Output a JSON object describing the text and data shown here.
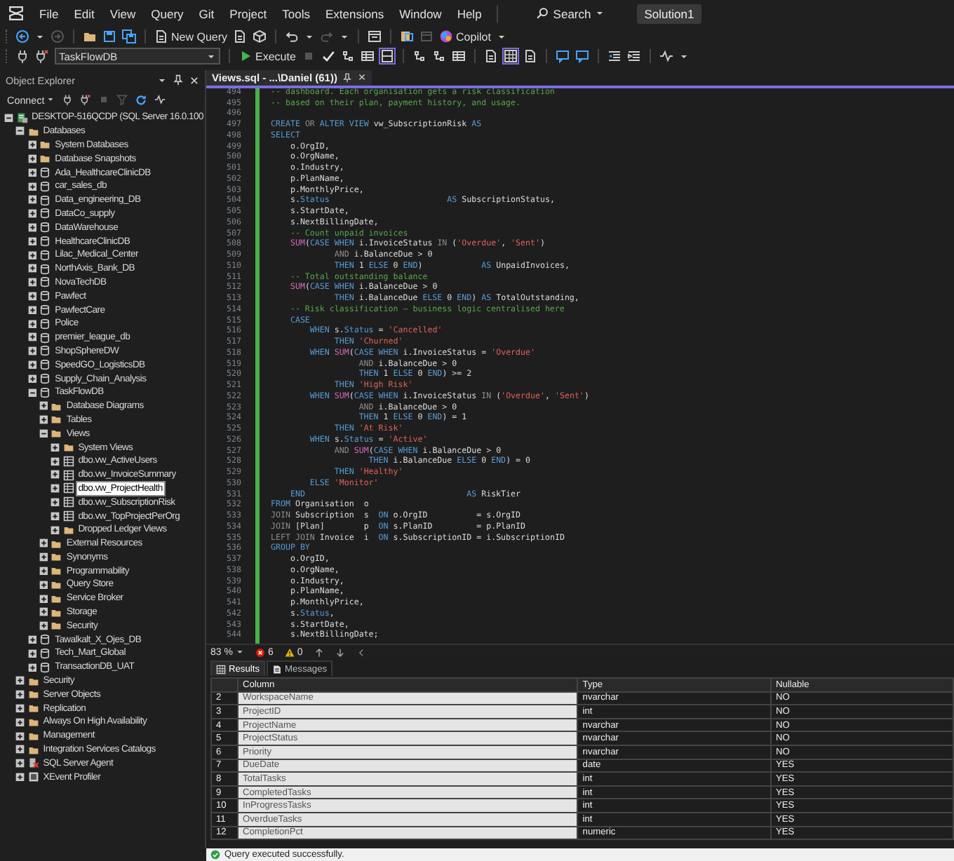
{
  "menu_bar": {
    "items": [
      "File",
      "Edit",
      "View",
      "Query",
      "Git",
      "Project",
      "Tools",
      "Extensions",
      "Window",
      "Help"
    ],
    "search": "Search",
    "solution": "Solution1"
  },
  "toolbar": {
    "new_query": "New Query",
    "copilot": "Copilot",
    "database": "TaskFlowDB",
    "execute": "Execute"
  },
  "object_explorer": {
    "title": "Object Explorer",
    "connect": "Connect",
    "tree": [
      {
        "label": "DESKTOP-516QCDP (SQL Server 16.0.100",
        "kind": "server",
        "expanded": true,
        "selected": false,
        "children": [
          {
            "label": "Databases",
            "kind": "folder",
            "expanded": true,
            "selected": false,
            "children": [
              {
                "label": "System Databases",
                "kind": "folder",
                "expanded": false,
                "selected": false
              },
              {
                "label": "Database Snapshots",
                "kind": "folder",
                "expanded": false,
                "selected": false
              },
              {
                "label": "Ada_HealthcareClinicDB",
                "kind": "database",
                "expanded": false,
                "selected": false
              },
              {
                "label": "car_sales_db",
                "kind": "database",
                "expanded": false,
                "selected": false
              },
              {
                "label": "Data_engineering_DB",
                "kind": "database",
                "expanded": false,
                "selected": false
              },
              {
                "label": "DataCo_supply",
                "kind": "database",
                "expanded": false,
                "selected": false
              },
              {
                "label": "DataWarehouse",
                "kind": "database",
                "expanded": false,
                "selected": false
              },
              {
                "label": "HealthcareClinicDB",
                "kind": "database",
                "expanded": false,
                "selected": false
              },
              {
                "label": "Lilac_Medical_Center",
                "kind": "database",
                "expanded": false,
                "selected": false
              },
              {
                "label": "NorthAxis_Bank_DB",
                "kind": "database",
                "expanded": false,
                "selected": false
              },
              {
                "label": "NovaTechDB",
                "kind": "database",
                "expanded": false,
                "selected": false
              },
              {
                "label": "Pawfect",
                "kind": "database",
                "expanded": false,
                "selected": false
              },
              {
                "label": "PawfectCare",
                "kind": "database",
                "expanded": false,
                "selected": false
              },
              {
                "label": "Police",
                "kind": "database",
                "expanded": false,
                "selected": false
              },
              {
                "label": "premier_league_db",
                "kind": "database",
                "expanded": false,
                "selected": false
              },
              {
                "label": "ShopSphereDW",
                "kind": "database",
                "expanded": false,
                "selected": false
              },
              {
                "label": "SpeedGO_LogisticsDB",
                "kind": "database",
                "expanded": false,
                "selected": false
              },
              {
                "label": "Supply_Chain_Analysis",
                "kind": "database",
                "expanded": false,
                "selected": false
              },
              {
                "label": "TaskFlowDB",
                "kind": "database",
                "expanded": true,
                "selected": false,
                "children": [
                  {
                    "label": "Database Diagrams",
                    "kind": "folder",
                    "expanded": false,
                    "selected": false
                  },
                  {
                    "label": "Tables",
                    "kind": "folder",
                    "expanded": false,
                    "selected": false
                  },
                  {
                    "label": "Views",
                    "kind": "folder",
                    "expanded": true,
                    "selected": false,
                    "children": [
                      {
                        "label": "System Views",
                        "kind": "folder",
                        "expanded": false,
                        "selected": false
                      },
                      {
                        "label": "dbo.vw_ActiveUsers",
                        "kind": "view",
                        "expanded": false,
                        "selected": false
                      },
                      {
                        "label": "dbo.vw_InvoiceSummary",
                        "kind": "view",
                        "expanded": false,
                        "selected": false
                      },
                      {
                        "label": "dbo.vw_ProjectHealth",
                        "kind": "view",
                        "expanded": false,
                        "selected": true
                      },
                      {
                        "label": "dbo.vw_SubscriptionRisk",
                        "kind": "view",
                        "expanded": false,
                        "selected": false
                      },
                      {
                        "label": "dbo.vw_TopProjectPerOrg",
                        "kind": "view",
                        "expanded": false,
                        "selected": false
                      },
                      {
                        "label": "Dropped Ledger Views",
                        "kind": "folder",
                        "expanded": false,
                        "selected": false
                      }
                    ]
                  },
                  {
                    "label": "External Resources",
                    "kind": "folder",
                    "expanded": false,
                    "selected": false
                  },
                  {
                    "label": "Synonyms",
                    "kind": "folder",
                    "expanded": false,
                    "selected": false
                  },
                  {
                    "label": "Programmability",
                    "kind": "folder",
                    "expanded": false,
                    "selected": false
                  },
                  {
                    "label": "Query Store",
                    "kind": "folder",
                    "expanded": false,
                    "selected": false
                  },
                  {
                    "label": "Service Broker",
                    "kind": "folder",
                    "expanded": false,
                    "selected": false
                  },
                  {
                    "label": "Storage",
                    "kind": "folder",
                    "expanded": false,
                    "selected": false
                  },
                  {
                    "label": "Security",
                    "kind": "folder",
                    "expanded": false,
                    "selected": false
                  }
                ]
              },
              {
                "label": "Tawalkalt_X_Ojes_DB",
                "kind": "database",
                "expanded": false,
                "selected": false
              },
              {
                "label": "Tech_Mart_Global",
                "kind": "database",
                "expanded": false,
                "selected": false
              },
              {
                "label": "TransactionDB_UAT",
                "kind": "database",
                "expanded": false,
                "selected": false
              }
            ]
          },
          {
            "label": "Security",
            "kind": "folder",
            "expanded": false,
            "selected": false
          },
          {
            "label": "Server Objects",
            "kind": "folder",
            "expanded": false,
            "selected": false
          },
          {
            "label": "Replication",
            "kind": "folder",
            "expanded": false,
            "selected": false
          },
          {
            "label": "Always On High Availability",
            "kind": "folder",
            "expanded": false,
            "selected": false
          },
          {
            "label": "Management",
            "kind": "folder",
            "expanded": false,
            "selected": false
          },
          {
            "label": "Integration Services Catalogs",
            "kind": "folder",
            "expanded": false,
            "selected": false
          },
          {
            "label": "SQL Server Agent",
            "kind": "agent",
            "expanded": false,
            "selected": false
          },
          {
            "label": "XEvent Profiler",
            "kind": "profiler",
            "expanded": false,
            "selected": false
          }
        ]
      }
    ]
  },
  "editor": {
    "tab": "Views.sql - ...\\Daniel (61))",
    "lines": [
      {
        "number": "494",
        "segments": [
          {
            "kind": "comment",
            "text": "-- dashboard. Each organisation gets a risk classification"
          }
        ]
      },
      {
        "number": "495",
        "segments": [
          {
            "kind": "comment",
            "text": "-- based on their plan, payment history, and usage."
          }
        ]
      },
      {
        "number": "496"
      },
      {
        "number": "497",
        "segments": [
          {
            "kind": "keyword",
            "text": "CREATE"
          },
          {
            "kind": "operator",
            "text": " OR "
          },
          {
            "kind": "keyword",
            "text": "ALTER VIEW "
          },
          {
            "kind": "plain",
            "text": "vw_SubscriptionRisk "
          },
          {
            "kind": "keyword",
            "text": "AS"
          }
        ]
      },
      {
        "number": "498",
        "segments": [
          {
            "kind": "keyword",
            "text": "SELECT"
          }
        ]
      },
      {
        "number": "499",
        "segments": [
          {
            "kind": "plain",
            "text": "    o.OrgID,"
          }
        ]
      },
      {
        "number": "500",
        "segments": [
          {
            "kind": "plain",
            "text": "    o.OrgName,"
          }
        ]
      },
      {
        "number": "501",
        "segments": [
          {
            "kind": "plain",
            "text": "    o.Industry,"
          }
        ]
      },
      {
        "number": "502",
        "segments": [
          {
            "kind": "plain",
            "text": "    p.PlanName,"
          }
        ]
      },
      {
        "number": "503",
        "segments": [
          {
            "kind": "plain",
            "text": "    p.MonthlyPrice,"
          }
        ]
      },
      {
        "number": "504",
        "segments": [
          {
            "kind": "plain",
            "text": "    s."
          },
          {
            "kind": "keyword",
            "text": "Status"
          },
          {
            "kind": "keyword",
            "text": "                        AS"
          },
          {
            "kind": "plain",
            "text": " SubscriptionStatus,"
          }
        ]
      },
      {
        "number": "505",
        "segments": [
          {
            "kind": "plain",
            "text": "    s.StartDate,"
          }
        ]
      },
      {
        "number": "506",
        "segments": [
          {
            "kind": "plain",
            "text": "    s.NextBillingDate,"
          }
        ]
      },
      {
        "number": "507",
        "segments": [
          {
            "kind": "comment",
            "text": "    -- Count unpaid invoices"
          }
        ]
      },
      {
        "number": "508",
        "segments": [
          {
            "kind": "function",
            "text": "    SUM"
          },
          {
            "kind": "plain",
            "text": "("
          },
          {
            "kind": "keyword",
            "text": "CASE WHEN "
          },
          {
            "kind": "plain",
            "text": "i.InvoiceStatus "
          },
          {
            "kind": "operator",
            "text": "IN"
          },
          {
            "kind": "plain",
            "text": " ("
          },
          {
            "kind": "string",
            "text": "'Overdue'"
          },
          {
            "kind": "plain",
            "text": ", "
          },
          {
            "kind": "string",
            "text": "'Sent'"
          },
          {
            "kind": "plain",
            "text": ")"
          }
        ]
      },
      {
        "number": "509",
        "segments": [
          {
            "kind": "operator",
            "text": "             AND "
          },
          {
            "kind": "plain",
            "text": "i.BalanceDue > 0"
          }
        ]
      },
      {
        "number": "510",
        "segments": [
          {
            "kind": "keyword",
            "text": "             THEN "
          },
          {
            "kind": "plain",
            "text": "1 "
          },
          {
            "kind": "keyword",
            "text": "ELSE "
          },
          {
            "kind": "plain",
            "text": "0 "
          },
          {
            "kind": "keyword",
            "text": "END"
          },
          {
            "kind": "plain",
            "text": ")            "
          },
          {
            "kind": "keyword",
            "text": "AS"
          },
          {
            "kind": "plain",
            "text": " UnpaidInvoices,"
          }
        ]
      },
      {
        "number": "511",
        "segments": [
          {
            "kind": "comment",
            "text": "    -- Total outstanding balance"
          }
        ]
      },
      {
        "number": "512",
        "segments": [
          {
            "kind": "function",
            "text": "    SUM"
          },
          {
            "kind": "plain",
            "text": "("
          },
          {
            "kind": "keyword",
            "text": "CASE WHEN "
          },
          {
            "kind": "plain",
            "text": "i.BalanceDue > 0"
          }
        ]
      },
      {
        "number": "513",
        "segments": [
          {
            "kind": "keyword",
            "text": "             THEN "
          },
          {
            "kind": "plain",
            "text": "i.BalanceDue "
          },
          {
            "kind": "keyword",
            "text": "ELSE "
          },
          {
            "kind": "plain",
            "text": "0 "
          },
          {
            "kind": "keyword",
            "text": "END"
          },
          {
            "kind": "plain",
            "text": ") "
          },
          {
            "kind": "keyword",
            "text": "AS"
          },
          {
            "kind": "plain",
            "text": " TotalOutstanding,"
          }
        ]
      },
      {
        "number": "514",
        "segments": [
          {
            "kind": "comment",
            "text": "    -- Risk classification — business logic centralised here"
          }
        ]
      },
      {
        "number": "515",
        "segments": [
          {
            "kind": "keyword",
            "text": "    CASE"
          }
        ]
      },
      {
        "number": "516",
        "segments": [
          {
            "kind": "keyword",
            "text": "        WHEN "
          },
          {
            "kind": "plain",
            "text": "s."
          },
          {
            "kind": "keyword",
            "text": "Status"
          },
          {
            "kind": "plain",
            "text": " = "
          },
          {
            "kind": "string",
            "text": "'Cancelled'"
          }
        ]
      },
      {
        "number": "517",
        "segments": [
          {
            "kind": "keyword",
            "text": "             THEN "
          },
          {
            "kind": "string",
            "text": "'Churned'"
          }
        ]
      },
      {
        "number": "518",
        "segments": [
          {
            "kind": "keyword",
            "text": "        WHEN "
          },
          {
            "kind": "function",
            "text": "SUM"
          },
          {
            "kind": "plain",
            "text": "("
          },
          {
            "kind": "keyword",
            "text": "CASE WHEN "
          },
          {
            "kind": "plain",
            "text": "i.InvoiceStatus = "
          },
          {
            "kind": "string",
            "text": "'Overdue'"
          }
        ]
      },
      {
        "number": "519",
        "segments": [
          {
            "kind": "operator",
            "text": "                  AND "
          },
          {
            "kind": "plain",
            "text": "i.BalanceDue > 0"
          }
        ]
      },
      {
        "number": "520",
        "segments": [
          {
            "kind": "keyword",
            "text": "                  THEN "
          },
          {
            "kind": "plain",
            "text": "1 "
          },
          {
            "kind": "keyword",
            "text": "ELSE "
          },
          {
            "kind": "plain",
            "text": "0 "
          },
          {
            "kind": "keyword",
            "text": "END"
          },
          {
            "kind": "plain",
            "text": ") >= 2"
          }
        ]
      },
      {
        "number": "521",
        "segments": [
          {
            "kind": "keyword",
            "text": "             THEN "
          },
          {
            "kind": "string",
            "text": "'High Risk'"
          }
        ]
      },
      {
        "number": "522",
        "segments": [
          {
            "kind": "keyword",
            "text": "        WHEN "
          },
          {
            "kind": "function",
            "text": "SUM"
          },
          {
            "kind": "plain",
            "text": "("
          },
          {
            "kind": "keyword",
            "text": "CASE WHEN "
          },
          {
            "kind": "plain",
            "text": "i.InvoiceStatus "
          },
          {
            "kind": "operator",
            "text": "IN"
          },
          {
            "kind": "plain",
            "text": " ("
          },
          {
            "kind": "string",
            "text": "'Overdue'"
          },
          {
            "kind": "plain",
            "text": ", "
          },
          {
            "kind": "string",
            "text": "'Sent'"
          },
          {
            "kind": "plain",
            "text": ")"
          }
        ]
      },
      {
        "number": "523",
        "segments": [
          {
            "kind": "operator",
            "text": "                  AND "
          },
          {
            "kind": "plain",
            "text": "i.BalanceDue > 0"
          }
        ]
      },
      {
        "number": "524",
        "segments": [
          {
            "kind": "keyword",
            "text": "                  THEN "
          },
          {
            "kind": "plain",
            "text": "1 "
          },
          {
            "kind": "keyword",
            "text": "ELSE "
          },
          {
            "kind": "plain",
            "text": "0 "
          },
          {
            "kind": "keyword",
            "text": "END"
          },
          {
            "kind": "plain",
            "text": ") = 1"
          }
        ]
      },
      {
        "number": "525",
        "segments": [
          {
            "kind": "keyword",
            "text": "             THEN "
          },
          {
            "kind": "string",
            "text": "'At Risk'"
          }
        ]
      },
      {
        "number": "526",
        "segments": [
          {
            "kind": "keyword",
            "text": "        WHEN "
          },
          {
            "kind": "plain",
            "text": "s."
          },
          {
            "kind": "keyword",
            "text": "Status"
          },
          {
            "kind": "plain",
            "text": " = "
          },
          {
            "kind": "string",
            "text": "'Active'"
          }
        ]
      },
      {
        "number": "527",
        "segments": [
          {
            "kind": "operator",
            "text": "             AND "
          },
          {
            "kind": "function",
            "text": "SUM"
          },
          {
            "kind": "plain",
            "text": "("
          },
          {
            "kind": "keyword",
            "text": "CASE WHEN "
          },
          {
            "kind": "plain",
            "text": "i.BalanceDue > 0"
          }
        ]
      },
      {
        "number": "528",
        "segments": [
          {
            "kind": "keyword",
            "text": "                    THEN "
          },
          {
            "kind": "plain",
            "text": "i.BalanceDue "
          },
          {
            "kind": "keyword",
            "text": "ELSE "
          },
          {
            "kind": "plain",
            "text": "0 "
          },
          {
            "kind": "keyword",
            "text": "END"
          },
          {
            "kind": "plain",
            "text": ") = 0"
          }
        ]
      },
      {
        "number": "529",
        "segments": [
          {
            "kind": "keyword",
            "text": "             THEN "
          },
          {
            "kind": "string",
            "text": "'Healthy'"
          }
        ]
      },
      {
        "number": "530",
        "segments": [
          {
            "kind": "keyword",
            "text": "        ELSE "
          },
          {
            "kind": "string",
            "text": "'Monitor'"
          }
        ]
      },
      {
        "number": "531",
        "segments": [
          {
            "kind": "keyword",
            "text": "    END"
          },
          {
            "kind": "keyword",
            "text": "                                 AS"
          },
          {
            "kind": "plain",
            "text": " RiskTier"
          }
        ]
      },
      {
        "number": "532",
        "segments": [
          {
            "kind": "keyword",
            "text": "FROM "
          },
          {
            "kind": "plain",
            "text": "Organisation  o"
          }
        ]
      },
      {
        "number": "533",
        "segments": [
          {
            "kind": "operator",
            "text": "JOIN "
          },
          {
            "kind": "plain",
            "text": "Subscription  s  "
          },
          {
            "kind": "keyword",
            "text": "ON "
          },
          {
            "kind": "plain",
            "text": "o.OrgID          = s.OrgID"
          }
        ]
      },
      {
        "number": "534",
        "segments": [
          {
            "kind": "operator",
            "text": "JOIN "
          },
          {
            "kind": "plain",
            "text": "[Plan]        p  "
          },
          {
            "kind": "keyword",
            "text": "ON "
          },
          {
            "kind": "plain",
            "text": "s.PlanID         = p.PlanID"
          }
        ]
      },
      {
        "number": "535",
        "segments": [
          {
            "kind": "operator",
            "text": "LEFT JOIN "
          },
          {
            "kind": "plain",
            "text": "Invoice  i  "
          },
          {
            "kind": "keyword",
            "text": "ON "
          },
          {
            "kind": "plain",
            "text": "s.SubscriptionID = i.SubscriptionID"
          }
        ]
      },
      {
        "number": "536",
        "segments": [
          {
            "kind": "keyword",
            "text": "GROUP BY"
          }
        ]
      },
      {
        "number": "537",
        "segments": [
          {
            "kind": "plain",
            "text": "    o.OrgID,"
          }
        ]
      },
      {
        "number": "538",
        "segments": [
          {
            "kind": "plain",
            "text": "    o.OrgName,"
          }
        ]
      },
      {
        "number": "539",
        "segments": [
          {
            "kind": "plain",
            "text": "    o.Industry,"
          }
        ]
      },
      {
        "number": "540",
        "segments": [
          {
            "kind": "plain",
            "text": "    p.PlanName,"
          }
        ]
      },
      {
        "number": "541",
        "segments": [
          {
            "kind": "plain",
            "text": "    p.MonthlyPrice,"
          }
        ]
      },
      {
        "number": "542",
        "segments": [
          {
            "kind": "plain",
            "text": "    s."
          },
          {
            "kind": "keyword",
            "text": "Status"
          },
          {
            "kind": "plain",
            "text": ","
          }
        ]
      },
      {
        "number": "543",
        "segments": [
          {
            "kind": "plain",
            "text": "    s.StartDate,"
          }
        ]
      },
      {
        "number": "544",
        "segments": [
          {
            "kind": "plain",
            "text": "    s.NextBillingDate;"
          }
        ]
      }
    ],
    "zoom": "83 %",
    "errors": "6",
    "warnings": "0"
  },
  "results": {
    "tabs": [
      {
        "label": "Results",
        "selected": true
      },
      {
        "label": "Messages",
        "selected": false
      }
    ],
    "columns": [
      "Column",
      "Type",
      "Nullable"
    ],
    "rows": [
      {
        "number": "2",
        "cells": [
          "WorkspaceName",
          "nvarchar",
          "NO"
        ]
      },
      {
        "number": "3",
        "cells": [
          "ProjectID",
          "int",
          "NO"
        ]
      },
      {
        "number": "4",
        "cells": [
          "ProjectName",
          "nvarchar",
          "NO"
        ]
      },
      {
        "number": "5",
        "cells": [
          "ProjectStatus",
          "nvarchar",
          "NO"
        ]
      },
      {
        "number": "6",
        "cells": [
          "Priority",
          "nvarchar",
          "NO"
        ]
      },
      {
        "number": "7",
        "cells": [
          "DueDate",
          "date",
          "YES"
        ]
      },
      {
        "number": "8",
        "cells": [
          "TotalTasks",
          "int",
          "YES"
        ]
      },
      {
        "number": "9",
        "cells": [
          "CompletedTasks",
          "int",
          "YES"
        ]
      },
      {
        "number": "10",
        "cells": [
          "InProgressTasks",
          "int",
          "YES"
        ]
      },
      {
        "number": "11",
        "cells": [
          "OverdueTasks",
          "int",
          "YES"
        ]
      },
      {
        "number": "12",
        "cells": [
          "CompletionPct",
          "numeric",
          "YES"
        ]
      }
    ]
  },
  "status_bar": {
    "message": "Query executed successfully."
  }
}
